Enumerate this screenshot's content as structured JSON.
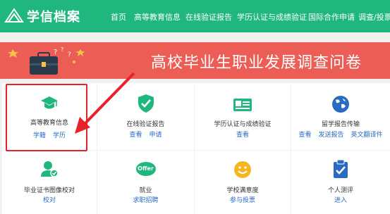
{
  "header": {
    "logo_text": "学信档案",
    "nav": [
      "首页",
      "高等教育信息",
      "在线验证报告",
      "学历认证与成绩验证",
      "国际合作申请",
      "调查/投票"
    ]
  },
  "banner": {
    "title": "高校毕业生职业发展调查问卷"
  },
  "cards": [
    {
      "label": "高等教育信息",
      "links": [
        "学籍",
        "学历"
      ],
      "icon": "graduation-cap-icon"
    },
    {
      "label": "在线验证报告",
      "links": [
        "查看",
        "申请"
      ],
      "icon": "shield-check-icon"
    },
    {
      "label": "学历认证与成绩验证",
      "links": [
        "查看"
      ],
      "icon": "certificate-icon"
    },
    {
      "label": "留学报告传输",
      "links": [
        "查看",
        "发送报告",
        "英文翻译件"
      ],
      "icon": "globe-icon"
    },
    {
      "label": "毕业证书图像校对",
      "links": [
        "校对"
      ],
      "icon": "user-check-icon"
    },
    {
      "label": "就业",
      "links": [
        "求职招聘"
      ],
      "icon": "offer-icon",
      "icon_text": "Offer"
    },
    {
      "label": "学校满意度",
      "links": [
        "参与投票"
      ],
      "icon": "smile-icon"
    },
    {
      "label": "个人测评",
      "links": [
        "进入"
      ],
      "icon": "clipboard-check-icon"
    }
  ],
  "colors": {
    "header": "#20b77f",
    "banner": "#ec5e55",
    "accent": "#20b77f",
    "link": "#2a6bc2",
    "highlight": "#e8222b"
  }
}
